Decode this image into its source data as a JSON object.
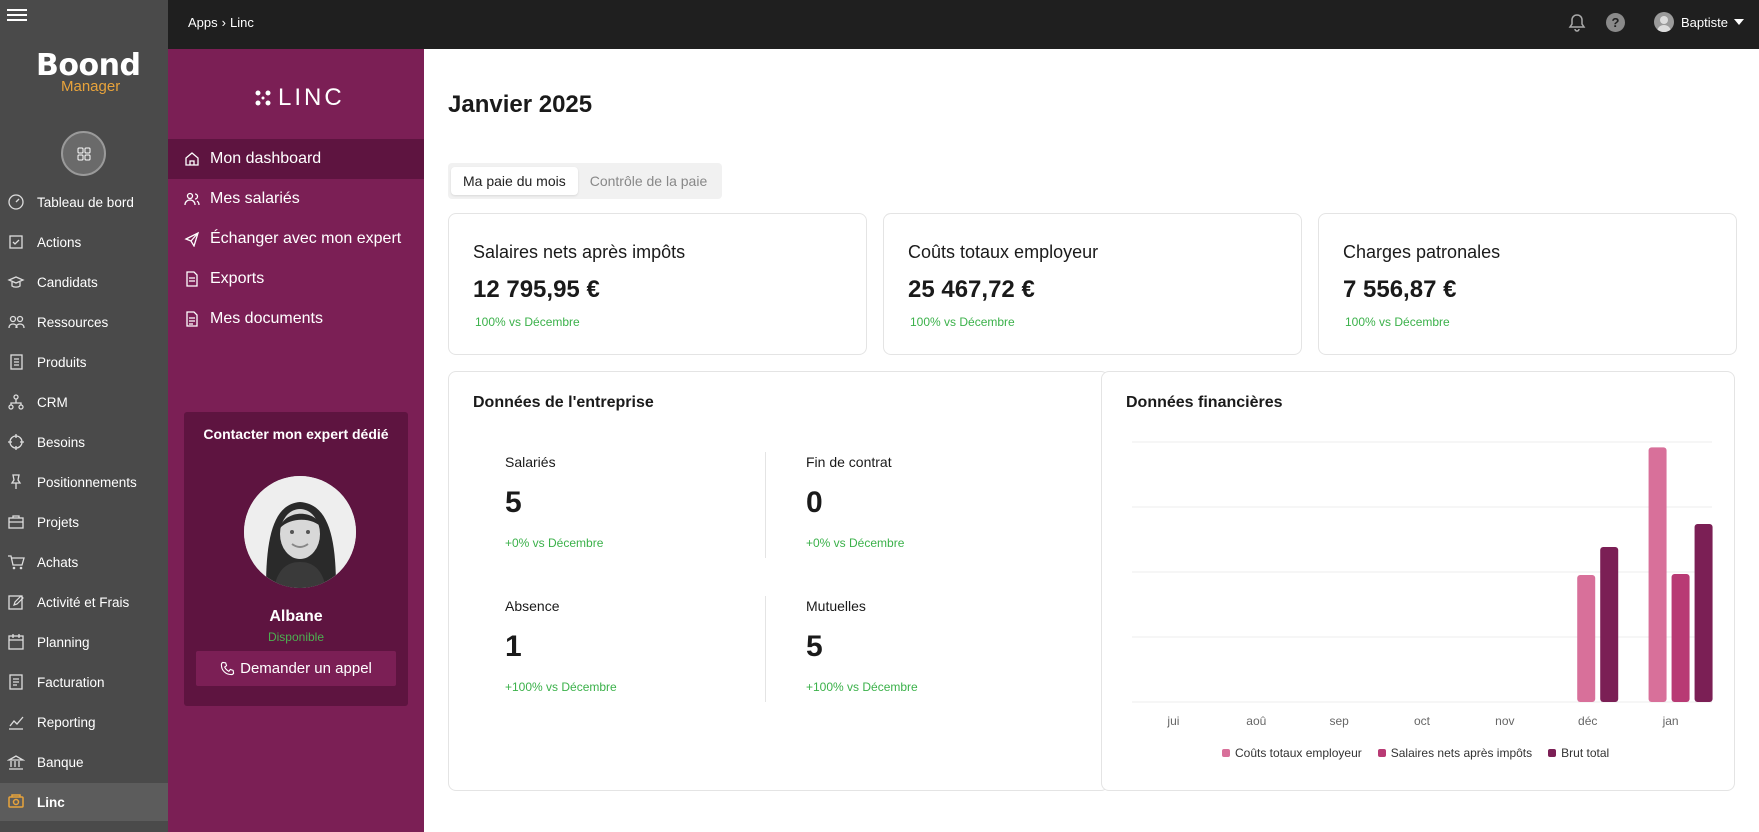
{
  "app": {
    "logo_line1": "Boond",
    "logo_line2": "Manager",
    "nav": [
      {
        "label": "Tableau de bord",
        "icon": "dashboard-icon"
      },
      {
        "label": "Actions",
        "icon": "actions-icon"
      },
      {
        "label": "Candidats",
        "icon": "graduation-cap-icon"
      },
      {
        "label": "Ressources",
        "icon": "people-icon"
      },
      {
        "label": "Produits",
        "icon": "book-icon"
      },
      {
        "label": "CRM",
        "icon": "network-icon"
      },
      {
        "label": "Besoins",
        "icon": "target-icon"
      },
      {
        "label": "Positionnements",
        "icon": "pin-icon"
      },
      {
        "label": "Projets",
        "icon": "briefcase-icon"
      },
      {
        "label": "Achats",
        "icon": "cart-icon"
      },
      {
        "label": "Activité et Frais",
        "icon": "edit-icon"
      },
      {
        "label": "Planning",
        "icon": "calendar-icon"
      },
      {
        "label": "Facturation",
        "icon": "invoice-icon"
      },
      {
        "label": "Reporting",
        "icon": "chart-line-icon"
      },
      {
        "label": "Banque",
        "icon": "bank-icon"
      },
      {
        "label": "Linc",
        "icon": "linc-icon",
        "active": true
      }
    ]
  },
  "topbar": {
    "crumb_1": "Apps",
    "crumb_2": "Linc",
    "user_name": "Baptiste",
    "help_label": "?"
  },
  "linc": {
    "logo_text": "LINC",
    "nav": [
      {
        "label": "Mon dashboard",
        "icon": "home-icon",
        "active": true
      },
      {
        "label": "Mes salariés",
        "icon": "users-icon"
      },
      {
        "label": "Échanger avec mon expert",
        "icon": "send-icon"
      },
      {
        "label": "Exports",
        "icon": "file-icon"
      },
      {
        "label": "Mes documents",
        "icon": "document-icon"
      }
    ],
    "expert": {
      "title": "Contacter mon expert dédié",
      "name": "Albane",
      "status": "Disponible",
      "call_label": "Demander un appel"
    }
  },
  "main": {
    "title": "Janvier 2025",
    "tabs": [
      "Ma paie du mois",
      "Contrôle de la paie"
    ],
    "kpis": [
      {
        "title": "Salaires nets après impôts",
        "value": "12 795,95 €",
        "delta": "100% vs Décembre"
      },
      {
        "title": "Coûts totaux employeur",
        "value": "25 467,72 €",
        "delta": "100% vs Décembre"
      },
      {
        "title": "Charges patronales",
        "value": "7 556,87 €",
        "delta": "100% vs Décembre"
      }
    ],
    "company": {
      "title": "Données de l'entreprise",
      "stats": [
        {
          "label": "Salariés",
          "value": "5",
          "delta": "+0% vs Décembre"
        },
        {
          "label": "Fin de contrat",
          "value": "0",
          "delta": "+0% vs Décembre"
        },
        {
          "label": "Absence",
          "value": "1",
          "delta": "+100% vs Décembre"
        },
        {
          "label": "Mutuelles",
          "value": "5",
          "delta": "+100% vs Décembre"
        }
      ]
    },
    "finance": {
      "title": "Données financières"
    }
  },
  "chart_data": {
    "type": "bar",
    "categories": [
      "jui",
      "aoû",
      "sep",
      "oct",
      "nov",
      "déc",
      "jan"
    ],
    "series": [
      {
        "name": "Coûts totaux employeur",
        "color": "#d8709a",
        "values": [
          0,
          0,
          0,
          0,
          0,
          12700,
          25468
        ]
      },
      {
        "name": "Salaires nets après impôts",
        "color": "#b83a74",
        "values": [
          0,
          0,
          0,
          0,
          0,
          null,
          12796
        ]
      },
      {
        "name": "Brut total",
        "color": "#7b1f55",
        "values": [
          0,
          0,
          0,
          0,
          0,
          15500,
          17800
        ]
      }
    ],
    "ylim": [
      0,
      26000
    ],
    "grid": true,
    "legend": "bottom"
  }
}
